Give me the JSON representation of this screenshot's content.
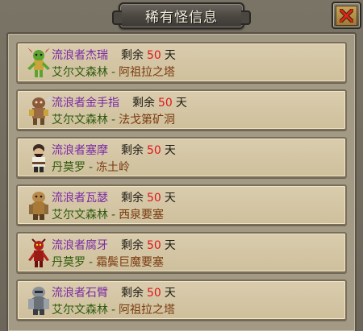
{
  "window": {
    "title": "稀有怪信息",
    "close_icon": "close-x-icon"
  },
  "labels": {
    "remain": "剩余",
    "unit": "天",
    "separator": "-"
  },
  "colors": {
    "monster_name": "#7b2aa4",
    "days": "#e0161a",
    "zone": "#2d5a0e",
    "place": "#7a3a10"
  },
  "monsters": [
    {
      "name": "流浪者杰瑞",
      "days": "50",
      "zone": "艾尔文森林",
      "place": "阿祖拉之塔",
      "icon": "green-goblin-icon"
    },
    {
      "name": "流浪者金手指",
      "days": "50",
      "zone": "艾尔文森林",
      "place": "法戈第矿洞",
      "icon": "kobold-miner-icon"
    },
    {
      "name": "流浪者塞摩",
      "days": "50",
      "zone": "丹莫罗",
      "place": "冻土岭",
      "icon": "dwarf-bandit-icon"
    },
    {
      "name": "流浪者瓦瑟",
      "days": "50",
      "zone": "艾尔文森林",
      "place": "西泉要塞",
      "icon": "gnoll-brute-icon"
    },
    {
      "name": "流浪者腐牙",
      "days": "50",
      "zone": "丹莫罗",
      "place": "霜鬓巨魔要塞",
      "icon": "red-troll-icon"
    },
    {
      "name": "流浪者石臂",
      "days": "50",
      "zone": "艾尔文森林",
      "place": "阿祖拉之塔",
      "icon": "armored-ogre-icon"
    }
  ]
}
